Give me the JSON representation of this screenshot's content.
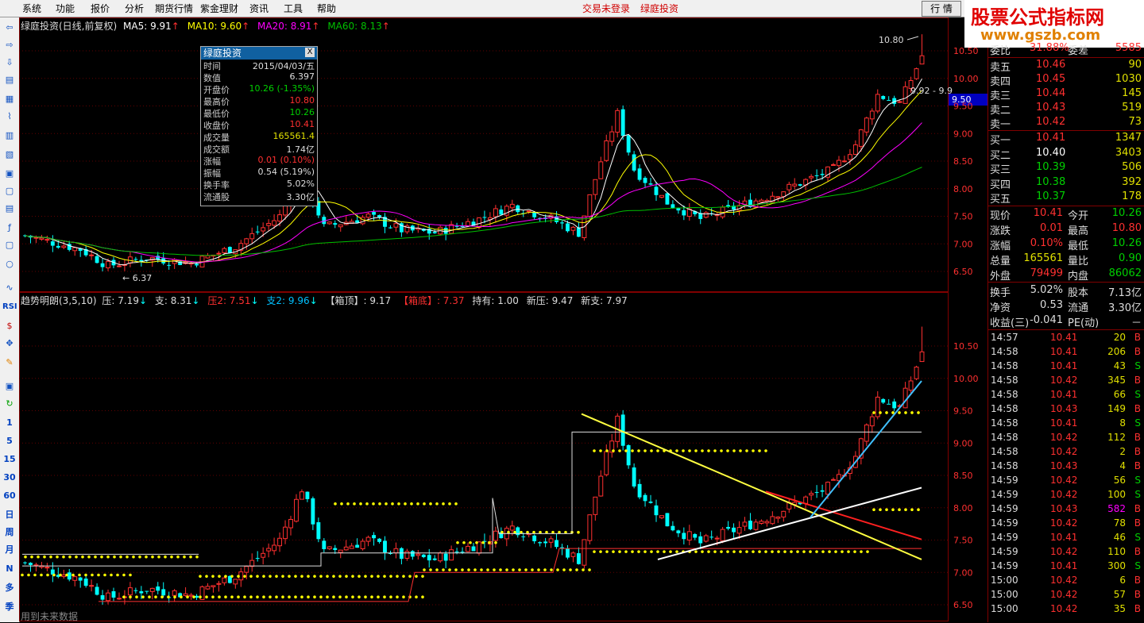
{
  "menu": {
    "items": [
      "系统",
      "功能",
      "报价",
      "分析",
      "期货行情",
      "紫金理财",
      "资讯",
      "工具",
      "帮助"
    ],
    "status1": "交易未登录",
    "status2": "绿庭投资",
    "quote_tab": "行 情"
  },
  "watermark": {
    "line1": "股票公式指标网",
    "line2": "www.gszb.com"
  },
  "toolbar": {
    "labels": [
      "1",
      "5",
      "15",
      "30",
      "60",
      "日",
      "周",
      "月",
      "N",
      "多",
      "季"
    ],
    "rsi": "RSI"
  },
  "main_header": {
    "title": "绿庭投资(日线,前复权)",
    "ma5": "MA5: 9.91",
    "ma10": "MA10: 9.60",
    "ma20": "MA20: 8.91",
    "ma60": "MA60: 8.13",
    "up": "↑"
  },
  "indicator_header": {
    "name": "趋势明朗(3,5,10)",
    "ya": "压: 7.19",
    "zhi": "支: 8.31",
    "ya2": "压2: 7.51",
    "zhi2": "支2: 9.96",
    "xiangding": "【箱顶】: 9.17",
    "xiangdi": "【箱底】: 7.37",
    "chiyou": "持有: 1.00",
    "xinya": "新压: 9.47",
    "xinzhi": "新支: 7.97",
    "down": "↓"
  },
  "footer_note": "用到未来数据",
  "annotations": {
    "high_label": "10.80",
    "low_label": "6.37",
    "range_label": "9.92 - 9.9",
    "price_tag": "9.50"
  },
  "price_axis": {
    "main": [
      "10.50",
      "10.00",
      "9.50",
      "9.00",
      "8.50",
      "8.00",
      "7.50",
      "7.00",
      "6.50"
    ],
    "sub": [
      "10.50",
      "10.00",
      "9.50",
      "9.00",
      "8.50",
      "8.00",
      "7.50",
      "7.00",
      "6.50"
    ]
  },
  "tooltip": {
    "title": "绿庭投资",
    "close": "X",
    "rows": [
      {
        "k": "时间",
        "v": "2015/04/03/五",
        "c": "#ddd"
      },
      {
        "k": "数值",
        "v": "6.397",
        "c": "#ddd"
      },
      {
        "k": "开盘价",
        "v": "10.26 (-1.35%)",
        "c": "#00d000"
      },
      {
        "k": "最高价",
        "v": "10.80",
        "c": "#ff3030"
      },
      {
        "k": "最低价",
        "v": "10.26",
        "c": "#00d000"
      },
      {
        "k": "收盘价",
        "v": "10.41",
        "c": "#ff3030"
      },
      {
        "k": "成交量",
        "v": "165561.4",
        "c": "#e0e000"
      },
      {
        "k": "成交额",
        "v": "1.74亿",
        "c": "#ddd"
      },
      {
        "k": "涨幅",
        "v": "0.01 (0.10%)",
        "c": "#ff3030"
      },
      {
        "k": "振幅",
        "v": "0.54 (5.19%)",
        "c": "#ddd"
      },
      {
        "k": "换手率",
        "v": "5.02%",
        "c": "#ddd"
      },
      {
        "k": "流通股",
        "v": "3.30亿",
        "c": "#ddd"
      }
    ]
  },
  "order_book": {
    "top": {
      "label": "委比",
      "value": "31.88%",
      "label2": "委差",
      "value2": "5585"
    },
    "asks": [
      {
        "label": "卖五",
        "price": "10.46",
        "vol": "90"
      },
      {
        "label": "卖四",
        "price": "10.45",
        "vol": "1030"
      },
      {
        "label": "卖三",
        "price": "10.44",
        "vol": "145"
      },
      {
        "label": "卖二",
        "price": "10.43",
        "vol": "519"
      },
      {
        "label": "卖一",
        "price": "10.42",
        "vol": "73"
      }
    ],
    "bids": [
      {
        "label": "买一",
        "price": "10.41",
        "vol": "1347",
        "pc": "#ff3030"
      },
      {
        "label": "买二",
        "price": "10.40",
        "vol": "3403",
        "pc": "#ffffff"
      },
      {
        "label": "买三",
        "price": "10.39",
        "vol": "506",
        "pc": "#00d000"
      },
      {
        "label": "买四",
        "price": "10.38",
        "vol": "392",
        "pc": "#00d000"
      },
      {
        "label": "买五",
        "price": "10.37",
        "vol": "178",
        "pc": "#00d000"
      }
    ]
  },
  "stats": [
    {
      "l1": "现价",
      "v1": "10.41",
      "c1": "#ff3030",
      "l2": "今开",
      "v2": "10.26",
      "c2": "#00d000"
    },
    {
      "l1": "涨跌",
      "v1": "0.01",
      "c1": "#ff3030",
      "l2": "最高",
      "v2": "10.80",
      "c2": "#ff3030"
    },
    {
      "l1": "涨幅",
      "v1": "0.10%",
      "c1": "#ff3030",
      "l2": "最低",
      "v2": "10.26",
      "c2": "#00d000"
    },
    {
      "l1": "总量",
      "v1": "165561",
      "c1": "#e0e000",
      "l2": "量比",
      "v2": "0.90",
      "c2": "#00d000"
    },
    {
      "l1": "外盘",
      "v1": "79499",
      "c1": "#ff3030",
      "l2": "内盘",
      "v2": "86062",
      "c2": "#00d000"
    }
  ],
  "stats2": [
    {
      "l1": "换手",
      "v1": "5.02%",
      "l2": "股本",
      "v2": "7.13亿"
    },
    {
      "l1": "净资",
      "v1": "0.53",
      "l2": "流通",
      "v2": "3.30亿"
    },
    {
      "l1": "收益(三)",
      "v1": "-0.041",
      "l2": "PE(动)",
      "v2": "－"
    }
  ],
  "ticks": [
    {
      "t": "14:57",
      "p": "10.41",
      "v": "20",
      "d": "B"
    },
    {
      "t": "14:58",
      "p": "10.41",
      "v": "206",
      "d": "B"
    },
    {
      "t": "14:58",
      "p": "10.41",
      "v": "43",
      "d": "S"
    },
    {
      "t": "14:58",
      "p": "10.42",
      "v": "345",
      "d": "B"
    },
    {
      "t": "14:58",
      "p": "10.41",
      "v": "66",
      "d": "S"
    },
    {
      "t": "14:58",
      "p": "10.43",
      "v": "149",
      "d": "B"
    },
    {
      "t": "14:58",
      "p": "10.41",
      "v": "8",
      "d": "S"
    },
    {
      "t": "14:58",
      "p": "10.42",
      "v": "112",
      "d": "B"
    },
    {
      "t": "14:58",
      "p": "10.42",
      "v": "2",
      "d": "B"
    },
    {
      "t": "14:58",
      "p": "10.43",
      "v": "4",
      "d": "B"
    },
    {
      "t": "14:59",
      "p": "10.42",
      "v": "56",
      "d": "S"
    },
    {
      "t": "14:59",
      "p": "10.42",
      "v": "100",
      "d": "S"
    },
    {
      "t": "14:59",
      "p": "10.43",
      "v": "582",
      "d": "B"
    },
    {
      "t": "14:59",
      "p": "10.42",
      "v": "78",
      "d": "B"
    },
    {
      "t": "14:59",
      "p": "10.41",
      "v": "46",
      "d": "S"
    },
    {
      "t": "14:59",
      "p": "10.42",
      "v": "110",
      "d": "B"
    },
    {
      "t": "14:59",
      "p": "10.41",
      "v": "300",
      "d": "S"
    },
    {
      "t": "15:00",
      "p": "10.42",
      "v": "6",
      "d": "B"
    },
    {
      "t": "15:00",
      "p": "10.42",
      "v": "57",
      "d": "B"
    },
    {
      "t": "15:00",
      "p": "10.42",
      "v": "35",
      "d": "B"
    }
  ],
  "colors": {
    "up": "#ff3030",
    "down": "#00ffff",
    "ma5": "#ffffff",
    "ma10": "#ffff00",
    "ma20": "#ff00ff",
    "ma60": "#00c000",
    "grid": "#800000"
  }
}
